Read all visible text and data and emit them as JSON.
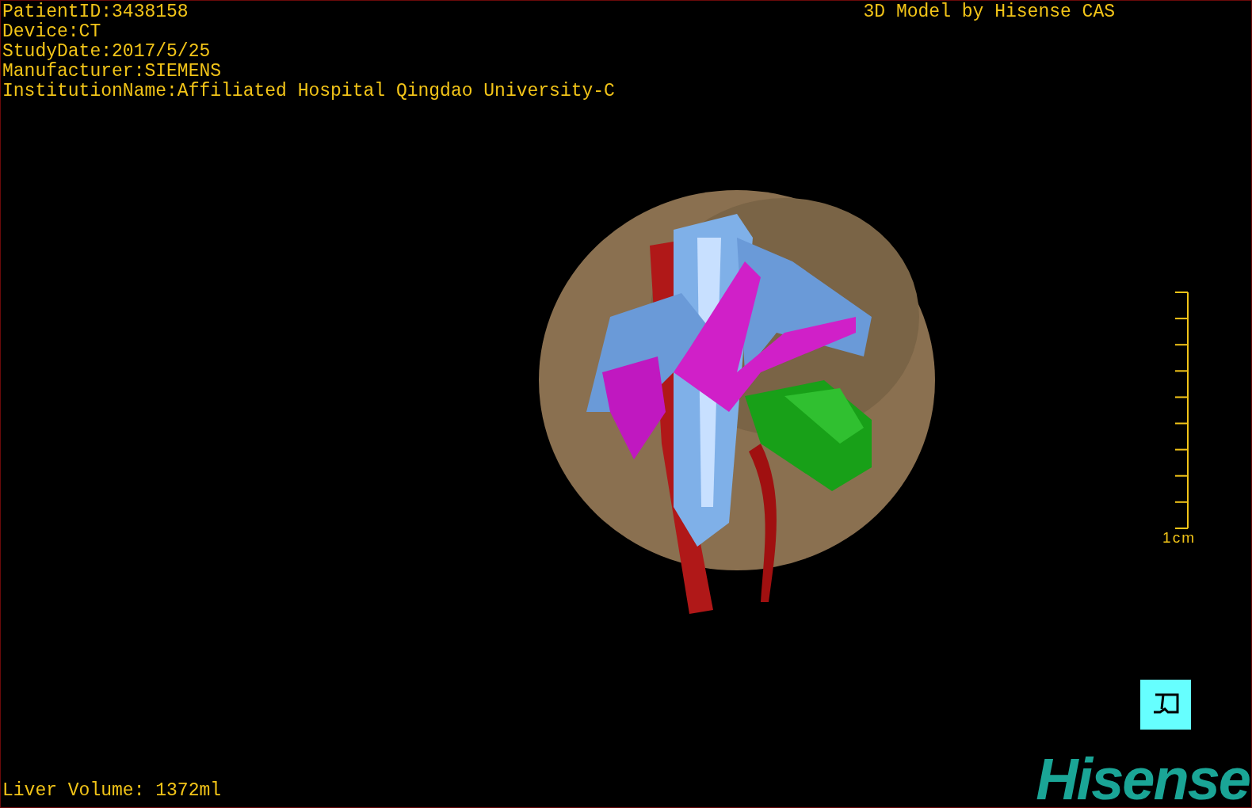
{
  "patient_info": [
    "PatientID:3438158",
    "Device:CT",
    "StudyDate:2017/5/25",
    "Manufacturer:SIEMENS",
    "InstitutionName:Affiliated Hospital Qingdao University-C"
  ],
  "model_credit": "3D Model by Hisense CAS",
  "scale_bar": {
    "label": "1cm"
  },
  "liver_volume": "Liver Volume: 1372ml",
  "logo": "Hisense"
}
